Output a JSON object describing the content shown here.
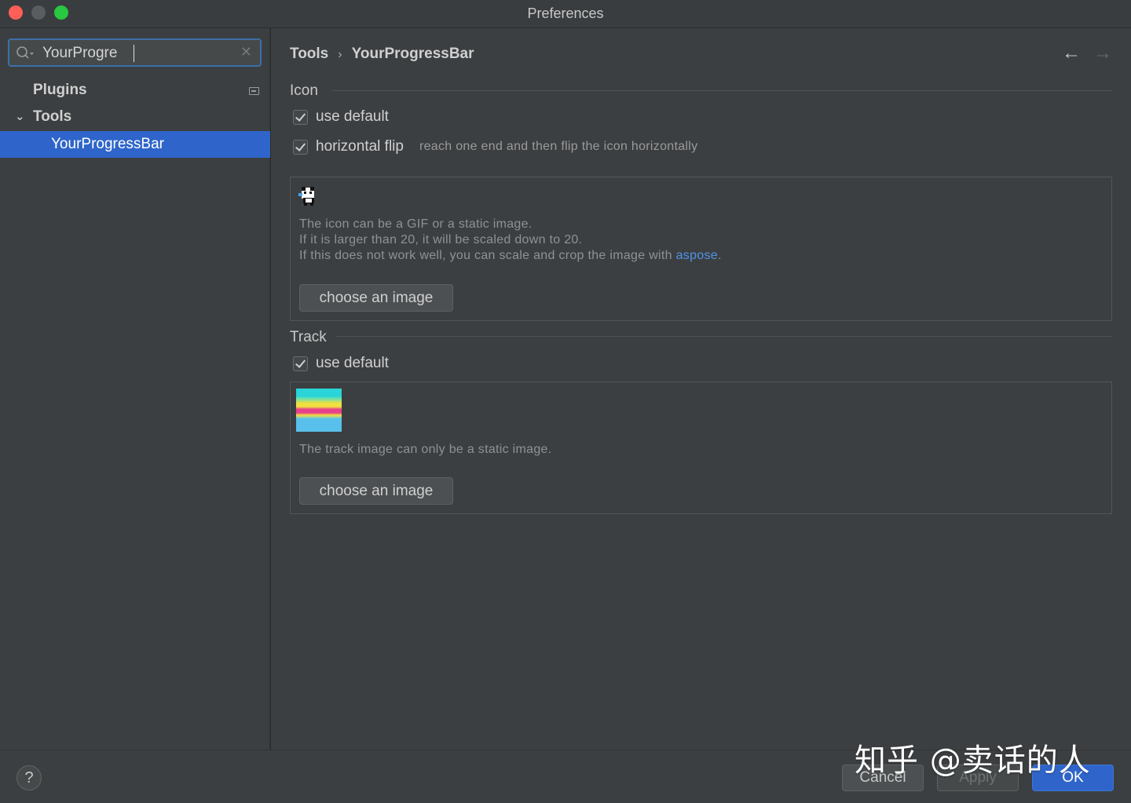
{
  "window": {
    "title": "Preferences"
  },
  "sidebar": {
    "search": {
      "value": "YourProgre",
      "placeholder": ""
    },
    "items": [
      {
        "label": "Plugins"
      },
      {
        "label": "Tools"
      },
      {
        "label": "YourProgressBar"
      }
    ]
  },
  "breadcrumb": {
    "parent": "Tools",
    "current": "YourProgressBar"
  },
  "icon_section": {
    "title": "Icon",
    "use_default": {
      "label": "use default",
      "checked": true
    },
    "horizontal_flip": {
      "label": "horizontal flip",
      "checked": true,
      "hint": "reach one end and then flip the icon horizontally"
    },
    "desc_line1": "The icon can be a GIF or a static image.",
    "desc_line2": "If it is larger than 20, it will be scaled down to 20.",
    "desc_line3_prefix": "If this does not work well, you can scale and crop the image with ",
    "desc_link": "aspose",
    "desc_line3_suffix": ".",
    "choose_button": "choose an image"
  },
  "track_section": {
    "title": "Track",
    "use_default": {
      "label": "use default",
      "checked": true
    },
    "desc": "The track image can only be a static image.",
    "choose_button": "choose an image"
  },
  "footer": {
    "help": "?",
    "cancel": "Cancel",
    "apply": "Apply",
    "ok": "OK"
  },
  "watermark": "知乎 @卖话的人",
  "colors": {
    "accent": "#2f65ca",
    "link": "#4f94e8",
    "background": "#3c3f41"
  }
}
